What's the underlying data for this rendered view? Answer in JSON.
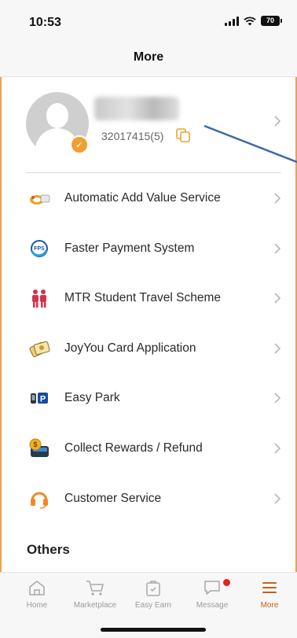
{
  "status_bar": {
    "time": "10:53",
    "battery": "70"
  },
  "header": {
    "title": "More"
  },
  "profile": {
    "member_id": "32017415(5)"
  },
  "menu": [
    {
      "label": "Automatic Add Value Service",
      "icon": "aavs-icon"
    },
    {
      "label": "Faster Payment System",
      "icon": "fps-icon"
    },
    {
      "label": "MTR Student Travel Scheme",
      "icon": "students-icon"
    },
    {
      "label": "JoyYou Card Application",
      "icon": "joyyou-card-icon"
    },
    {
      "label": "Easy Park",
      "icon": "parking-icon"
    },
    {
      "label": "Collect Rewards / Refund",
      "icon": "rewards-wallet-icon"
    },
    {
      "label": "Customer Service",
      "icon": "headset-icon"
    }
  ],
  "section": {
    "others": "Others"
  },
  "tabbar": [
    {
      "label": "Home",
      "icon": "home-icon"
    },
    {
      "label": "Marketplace",
      "icon": "cart-icon"
    },
    {
      "label": "Easy Earn",
      "icon": "bag-icon"
    },
    {
      "label": "Message",
      "icon": "chat-icon",
      "badge": true
    },
    {
      "label": "More",
      "icon": "menu-icon",
      "active": true
    }
  ],
  "colors": {
    "accent": "#f0a030",
    "active_tab": "#c8601a",
    "badge": "#e82020",
    "annotation_arrow": "#3a6aa8"
  }
}
